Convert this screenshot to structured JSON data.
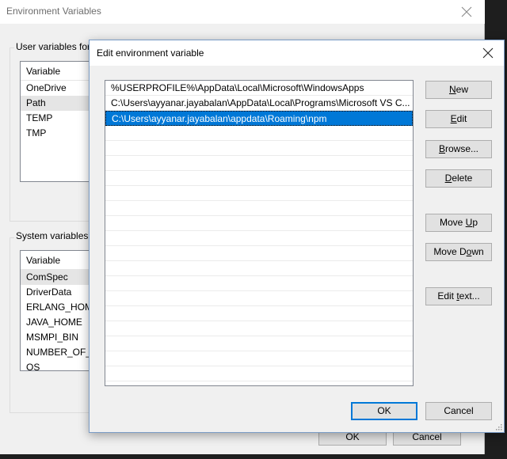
{
  "env_window": {
    "title": "Environment Variables",
    "user_group_label": "User variables for",
    "user_list": {
      "header": "Variable",
      "rows": [
        "OneDrive",
        "Path",
        "TEMP",
        "TMP"
      ],
      "selected_index": 1
    },
    "system_group_label": "System variables",
    "system_list": {
      "header": "Variable",
      "rows": [
        "ComSpec",
        "DriverData",
        "ERLANG_HOME",
        "JAVA_HOME",
        "MSMPI_BIN",
        "NUMBER_OF_P",
        "OS"
      ],
      "selected_index": 0
    },
    "ok_label": "OK",
    "cancel_label": "Cancel"
  },
  "edit_dialog": {
    "title": "Edit environment variable",
    "paths": [
      "%USERPROFILE%\\AppData\\Local\\Microsoft\\WindowsApps",
      "C:\\Users\\ayyanar.jayabalan\\AppData\\Local\\Programs\\Microsoft VS C...",
      "C:\\Users\\ayyanar.jayabalan\\appdata\\Roaming\\npm"
    ],
    "selected_index": 2,
    "buttons": {
      "new": {
        "pre": "",
        "key": "N",
        "post": "ew"
      },
      "edit": {
        "pre": "",
        "key": "E",
        "post": "dit"
      },
      "browse": {
        "pre": "",
        "key": "B",
        "post": "rowse..."
      },
      "delete": {
        "pre": "",
        "key": "D",
        "post": "elete"
      },
      "move_up": {
        "pre": "Move ",
        "key": "U",
        "post": "p"
      },
      "move_down": {
        "pre": "Move D",
        "key": "o",
        "post": "wn"
      },
      "edit_text": {
        "pre": "Edit ",
        "key": "t",
        "post": "ext..."
      }
    },
    "ok_label": "OK",
    "cancel_label": "Cancel"
  },
  "icons": {
    "close": "close-icon",
    "resize": "size-grip-icon"
  },
  "colors": {
    "selection": "#0078d7",
    "default_button_border": "#0078d7"
  }
}
